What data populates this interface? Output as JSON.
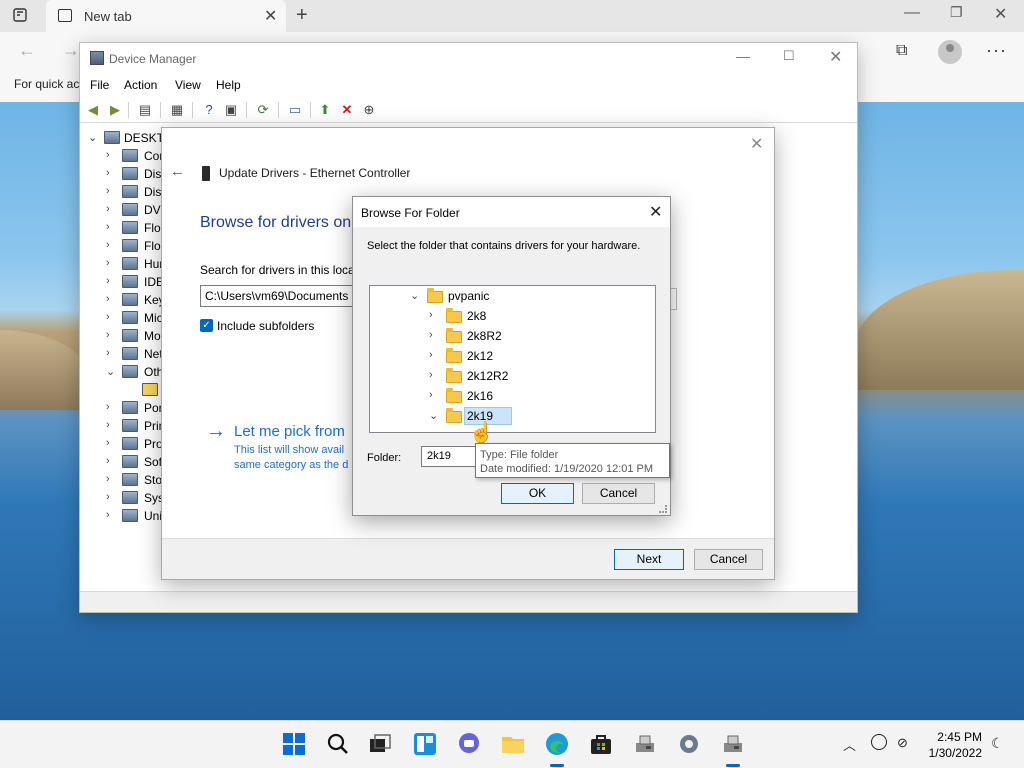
{
  "browser": {
    "tab_title": "New tab",
    "favorites_hint": "For quick ac",
    "colors": {
      "tab_bar": "#e6e6e6",
      "toolbar": "#f7f7f7"
    }
  },
  "device_manager": {
    "title": "Device Manager",
    "menu": [
      "File",
      "Action",
      "View",
      "Help"
    ],
    "tree_root": "DESKTO",
    "tree_items": [
      "Cor",
      "Disk",
      "Disp",
      "DVD",
      "Flop",
      "Flop",
      "Hum",
      "IDE",
      "Key",
      "Mic",
      "Mo",
      "Net",
      "Oth",
      "",
      "Por",
      "Prin",
      "Pro",
      "Soft",
      "Stor",
      "Syst",
      "Uni"
    ]
  },
  "update_wizard": {
    "title": "Update Drivers - Ethernet Controller",
    "heading": "Browse for drivers on",
    "search_label": "Search for drivers in this locat",
    "path_value": "C:\\Users\\vm69\\Documents",
    "include_subfolders_label": "Include subfolders",
    "pick_title": "Let me pick from",
    "pick_desc_line1": "This list will show avail",
    "pick_desc_line2": "same category as the d",
    "next_label": "Next",
    "cancel_label": "Cancel",
    "accent_color": "#1e6ec8"
  },
  "browse_folder": {
    "title": "Browse For Folder",
    "instruction": "Select the folder that contains drivers for your hardware.",
    "tree": [
      {
        "label": "pvpanic",
        "expanded": true
      },
      {
        "label": "2k8",
        "expanded": false
      },
      {
        "label": "2k8R2",
        "expanded": false
      },
      {
        "label": "2k12",
        "expanded": false
      },
      {
        "label": "2k12R2",
        "expanded": false
      },
      {
        "label": "2k16",
        "expanded": false
      },
      {
        "label": "2k19",
        "expanded": true,
        "selected": true
      }
    ],
    "folder_label": "Folder:",
    "folder_value": "2k19",
    "ok_label": "OK",
    "cancel_label": "Cancel"
  },
  "tooltip": {
    "line1": "Type: File folder",
    "line2": "Date modified: 1/19/2020 12:01 PM"
  },
  "taskbar": {
    "time": "2:45 PM",
    "date": "1/30/2022"
  }
}
